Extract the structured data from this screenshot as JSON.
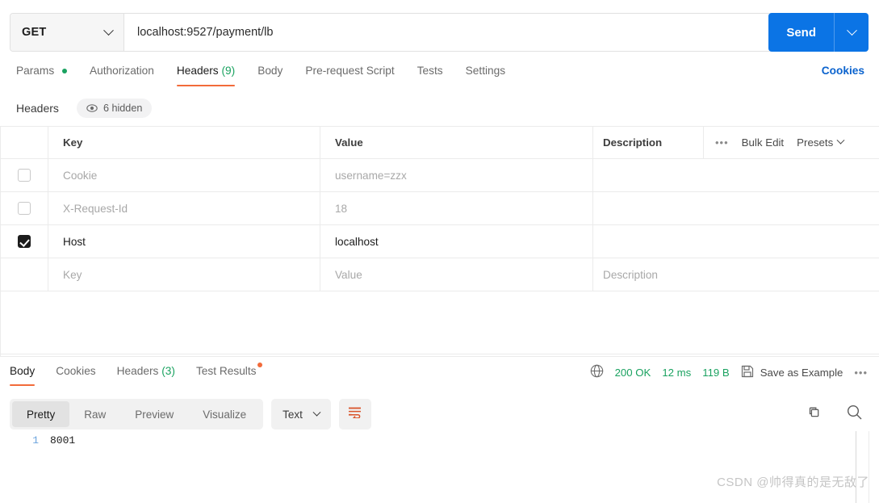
{
  "request": {
    "method": "GET",
    "url": "localhost:9527/payment/lb",
    "send_label": "Send",
    "send_caret_icon": "chevron-down-icon",
    "method_caret_icon": "chevron-down-icon"
  },
  "request_tabs": [
    {
      "label": "Params",
      "has_dot": true,
      "active": false
    },
    {
      "label": "Authorization",
      "has_dot": false,
      "active": false
    },
    {
      "label": "Headers",
      "count": "(9)",
      "has_dot": false,
      "active": true
    },
    {
      "label": "Body",
      "has_dot": false,
      "active": false
    },
    {
      "label": "Pre-request Script",
      "has_dot": false,
      "active": false
    },
    {
      "label": "Tests",
      "has_dot": false,
      "active": false
    },
    {
      "label": "Settings",
      "has_dot": false,
      "active": false
    }
  ],
  "cookies_link": "Cookies",
  "headers_section": {
    "title": "Headers",
    "hidden_badge": "6 hidden",
    "hidden_icon": "eye-icon"
  },
  "table": {
    "columns": [
      "Key",
      "Value",
      "Description"
    ],
    "tools": {
      "more_icon": "ellipsis-icon",
      "bulk_edit": "Bulk Edit",
      "presets": "Presets",
      "presets_caret_icon": "chevron-down-icon"
    },
    "rows": [
      {
        "checked": false,
        "key": "Cookie",
        "value": "username=zzx",
        "description": "",
        "dim": true
      },
      {
        "checked": false,
        "key": "X-Request-Id",
        "value": "18",
        "description": "",
        "dim": true
      },
      {
        "checked": true,
        "key": "Host",
        "value": "localhost",
        "description": "",
        "dim": false
      }
    ],
    "placeholder_row": {
      "key": "Key",
      "value": "Value",
      "description": "Description"
    }
  },
  "response": {
    "tabs": [
      {
        "label": "Body",
        "active": true
      },
      {
        "label": "Cookies",
        "active": false
      },
      {
        "label": "Headers",
        "count": "(3)",
        "active": false
      },
      {
        "label": "Test Results",
        "active": false,
        "has_dot": true
      }
    ],
    "meta": {
      "globe_icon": "globe-icon",
      "status": "200 OK",
      "time": "12 ms",
      "size": "119 B",
      "save_icon": "save-icon",
      "save_label": "Save as Example",
      "more_icon": "ellipsis-icon"
    },
    "format_tabs": [
      {
        "label": "Pretty",
        "active": true
      },
      {
        "label": "Raw",
        "active": false
      },
      {
        "label": "Preview",
        "active": false
      },
      {
        "label": "Visualize",
        "active": false
      }
    ],
    "language": "Text",
    "language_caret_icon": "chevron-down-icon",
    "wrap_icon": "word-wrap-icon",
    "copy_icon": "copy-icon",
    "search_icon": "search-icon",
    "body_lines": [
      {
        "number": "1",
        "text": "8001"
      }
    ]
  },
  "watermark": "CSDN @帅得真的是无敌了",
  "colors": {
    "accent_orange": "#f26b3a",
    "brand_blue": "#0b74e5",
    "status_green": "#1aa260",
    "link_blue": "#0b63ce"
  }
}
